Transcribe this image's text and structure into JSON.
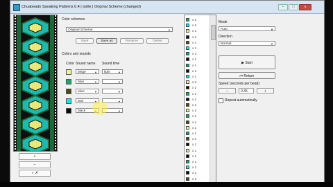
{
  "window": {
    "title": "Chuabeads Speaking Patterns 0.4 | turtle | Original Scheme (changed)",
    "controls": {
      "minimize": "–",
      "maximize": "□",
      "close": "x"
    }
  },
  "pattern": {
    "colors": {
      "black": "#101010",
      "teal": "#1fc0b5",
      "green": "#1e6b3c",
      "yellow": "#f2f07a",
      "white": "#ffffff"
    },
    "buttons": {
      "add": "+",
      "remove": "–",
      "confirm": "✓ ✗"
    }
  },
  "scheme": {
    "color_schemes_label": "Color schemes",
    "selected": "Original Scheme",
    "buttons": {
      "save": "Save",
      "save_as": "Save as",
      "rename": "Rename",
      "delete": "Delete"
    },
    "colors_sounds_label": "Colors and sounds",
    "headers": {
      "color": "Color",
      "sound_name": "Sound name",
      "sound_time": "Sound time"
    },
    "rows": [
      {
        "color": "#f3f293",
        "sound": "beige",
        "time": "light"
      },
      {
        "color": "#1fa16e",
        "sound": "blue",
        "time": ""
      },
      {
        "color": "#4d4713",
        "sound": "olive",
        "time": ""
      },
      {
        "color": "#22e0e6",
        "sound": "teal",
        "time": ""
      },
      {
        "color": "#0b0b0b",
        "sound": "black",
        "time": ""
      }
    ]
  },
  "beads": [
    {
      "color": "#1fa16e",
      "text": "x 2"
    },
    {
      "color": "#22e0e6",
      "text": "x 2"
    },
    {
      "color": "#f3f293",
      "text": "x 1"
    },
    {
      "color": "#0b0b0b",
      "text": "x 1"
    },
    {
      "color": "#4d4713",
      "text": "x 1"
    },
    {
      "color": "#22e0e6",
      "text": "x 1"
    },
    {
      "color": "#1fa16e",
      "text": "x 2"
    },
    {
      "color": "#0b0b0b",
      "text": "x 1"
    },
    {
      "color": "#1fa16e",
      "text": "x 1"
    },
    {
      "color": "#0b0b0b",
      "text": "x 1"
    },
    {
      "color": "#22e0e6",
      "text": "x 1"
    },
    {
      "color": "#f3f293",
      "text": "x 2"
    },
    {
      "color": "#0b0b0b",
      "text": "x 2"
    },
    {
      "color": "#1fa16e",
      "text": "x 1"
    },
    {
      "color": "#0b0b0b",
      "text": "x 1"
    },
    {
      "color": "#4d4713",
      "text": "x 1"
    },
    {
      "color": "#f3f293",
      "text": "x 2"
    },
    {
      "color": "#1fa16e",
      "text": "x 1"
    },
    {
      "color": "#4d4713",
      "text": "x 1"
    },
    {
      "color": "#f3f293",
      "text": "x 1"
    },
    {
      "color": "#1fa16e",
      "text": "x 1"
    },
    {
      "color": "#4d4713",
      "text": "x 1"
    },
    {
      "color": "#0b0b0b",
      "text": "x 1"
    },
    {
      "color": "#f3f293",
      "text": "x 1"
    },
    {
      "color": "#0b0b0b",
      "text": "x 1"
    },
    {
      "color": "#1fa16e",
      "text": "x 1"
    },
    {
      "color": "#22e0e6",
      "text": "x 1"
    },
    {
      "color": "#0b0b0b",
      "text": "x 1"
    },
    {
      "color": "#4d4713",
      "text": "x 2"
    }
  ],
  "controls": {
    "mode_label": "Mode",
    "mode": "Auto",
    "direction_label": "Direction",
    "direction": "Normal",
    "start": "▶ Start",
    "return": "⏮ Return",
    "speed_label": "Speed (seconds per bead)",
    "minus": "–",
    "speed": "0.35",
    "plus": "+",
    "repeat_label": "Repeat automatically"
  }
}
